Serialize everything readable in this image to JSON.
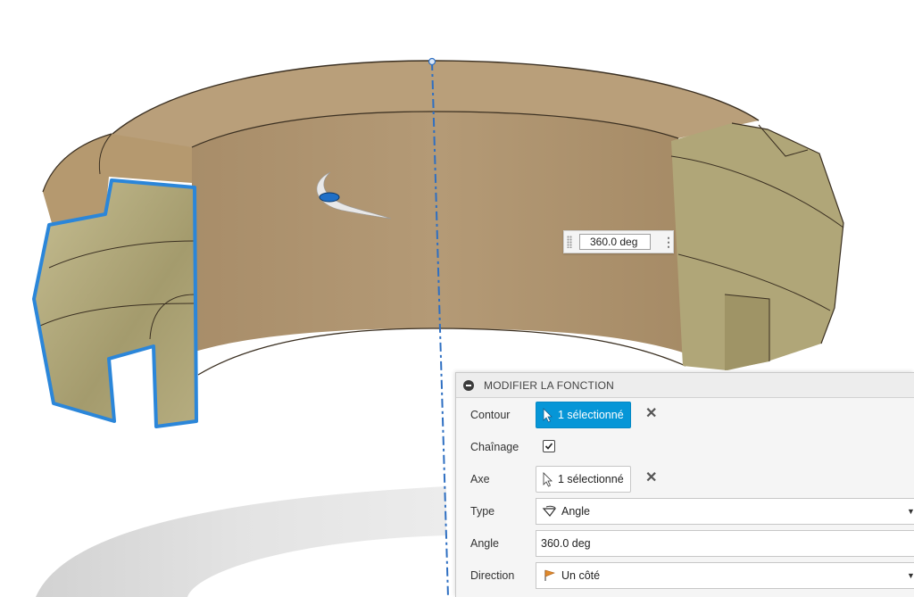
{
  "canvas": {
    "angle_value": "360.0 deg",
    "colors": {
      "body": "#b89e78",
      "profile_face": "#bab384",
      "selection": "#2b86d9",
      "axis": "#2e6fc2"
    }
  },
  "panel": {
    "title": "MODIFIER LA FONCTION",
    "rows": {
      "profile": {
        "label": "Contour",
        "value": "1 sélectionné"
      },
      "chaining": {
        "label": "Chaînage",
        "checked": true
      },
      "axis": {
        "label": "Axe",
        "value": "1 sélectionné"
      },
      "type": {
        "label": "Type",
        "value": "Angle",
        "icon": "angle-icon"
      },
      "angle": {
        "label": "Angle",
        "value": "360.0 deg"
      },
      "direction": {
        "label": "Direction",
        "value": "Un côté",
        "icon": "flag-icon"
      }
    }
  }
}
